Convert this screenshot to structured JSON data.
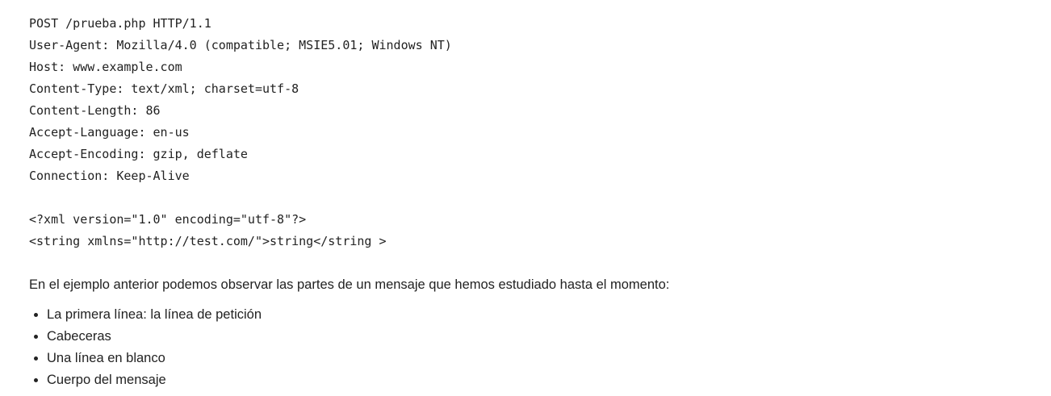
{
  "code": {
    "lines": [
      "POST /prueba.php HTTP/1.1",
      "User-Agent: Mozilla/4.0 (compatible; MSIE5.01; Windows NT)",
      "Host: www.example.com",
      "Content-Type: text/xml; charset=utf-8",
      "Content-Length: 86",
      "Accept-Language: en-us",
      "Accept-Encoding: gzip, deflate",
      "Connection: Keep-Alive",
      "",
      "<?xml version=\"1.0\" encoding=\"utf-8\"?>",
      "<string xmlns=\"http://test.com/\">string</string >"
    ]
  },
  "intro": "En el ejemplo anterior podemos observar las partes de un mensaje que hemos estudiado hasta el momento:",
  "parts": [
    "La primera línea: la línea de petición",
    "Cabeceras",
    "Una línea en blanco",
    "Cuerpo del mensaje"
  ]
}
